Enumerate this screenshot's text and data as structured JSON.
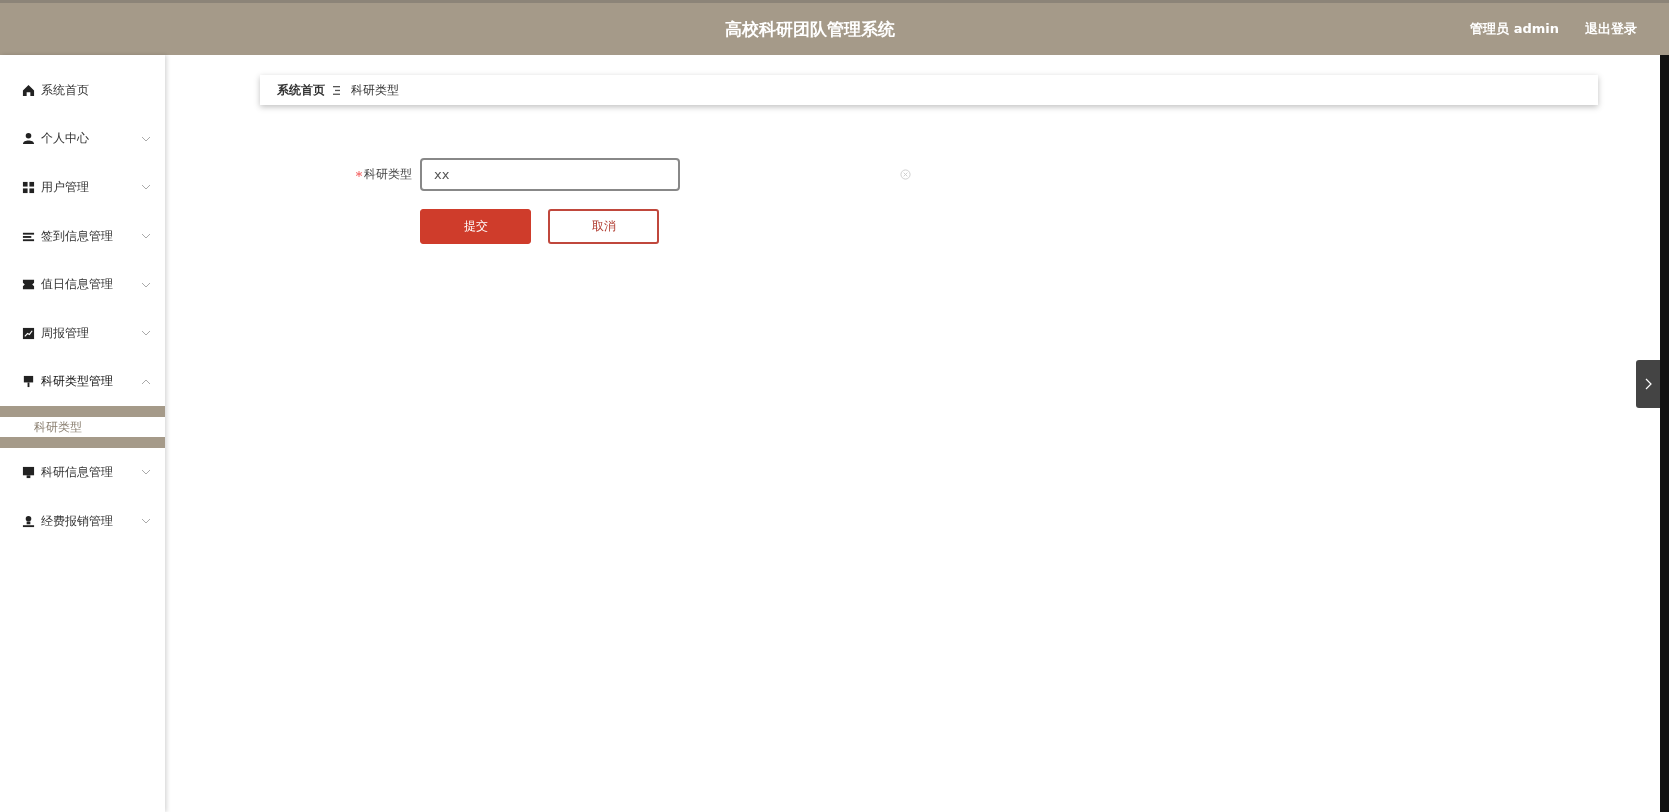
{
  "header": {
    "title": "高校科研团队管理系统",
    "user": "管理员 admin",
    "logout": "退出登录"
  },
  "sidebar": {
    "items": [
      {
        "label": "系统首页"
      },
      {
        "label": "个人中心",
        "expanded": false
      },
      {
        "label": "用户管理",
        "expanded": false
      },
      {
        "label": "签到信息管理",
        "expanded": false
      },
      {
        "label": "值日信息管理",
        "expanded": false
      },
      {
        "label": "周报管理",
        "expanded": false
      },
      {
        "label": "科研类型管理",
        "expanded": true,
        "children": [
          {
            "label": "科研类型",
            "selected": true
          }
        ]
      },
      {
        "label": "科研信息管理",
        "expanded": false
      },
      {
        "label": "经费报销管理",
        "expanded": false
      }
    ]
  },
  "breadcrumb": [
    "系统首页",
    "科研类型"
  ],
  "form": {
    "required": true,
    "label": "科研类型",
    "value": "xx",
    "buttons": [
      {
        "label": "提交",
        "kind": "primary"
      },
      {
        "label": "取消",
        "kind": "secondary"
      }
    ]
  }
}
